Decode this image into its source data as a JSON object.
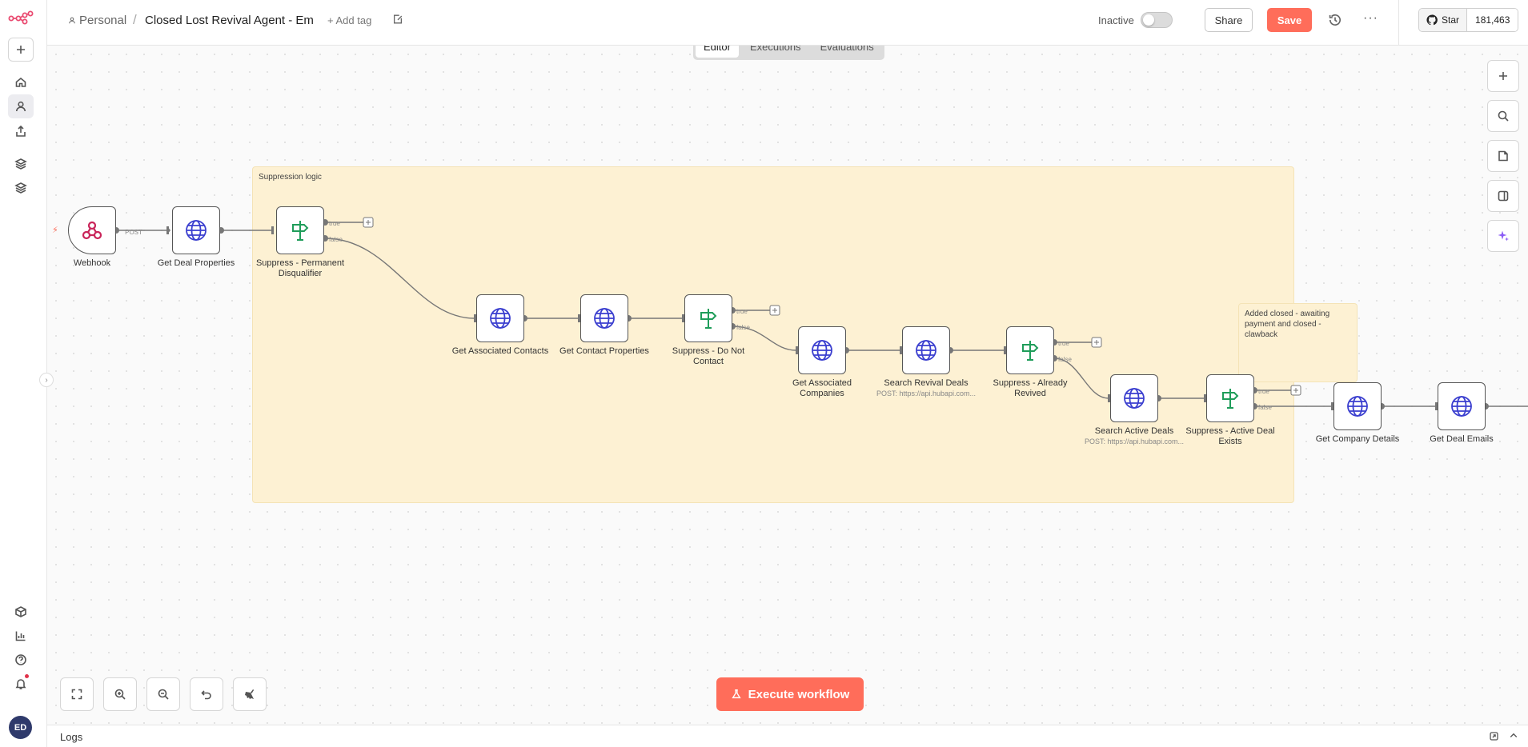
{
  "header": {
    "owner": "Personal",
    "separator": "/",
    "title": "Closed Lost Revival Agent - Em",
    "add_tag": "+ Add tag",
    "status_label": "Inactive",
    "share": "Share",
    "save": "Save",
    "more": "···",
    "github_star": "Star",
    "github_count": "181,463"
  },
  "tabs": [
    {
      "label": "Editor",
      "active": true
    },
    {
      "label": "Executions",
      "active": false
    },
    {
      "label": "Evaluations",
      "active": false
    }
  ],
  "stickies": {
    "suppression": "Suppression logic",
    "awaiting": "Added closed - awaiting payment and closed - clawback"
  },
  "nodes": {
    "webhook": {
      "label": "Webhook",
      "icon": "webhook-icon"
    },
    "get_deal_properties": {
      "label": "Get Deal Properties",
      "icon": "globe-icon"
    },
    "suppress_permanent": {
      "label": "Suppress - Permanent Disqualifier",
      "icon": "signpost-icon"
    },
    "get_associated_contacts": {
      "label": "Get Associated Contacts",
      "icon": "globe-icon"
    },
    "get_contact_properties": {
      "label": "Get Contact Properties",
      "icon": "globe-icon"
    },
    "suppress_do_not_contact": {
      "label": "Suppress - Do Not Contact",
      "icon": "signpost-icon"
    },
    "get_associated_companies": {
      "label": "Get Associated Companies",
      "icon": "globe-icon"
    },
    "search_revival_deals": {
      "label": "Search Revival Deals",
      "sub": "POST: https://api.hubapi.com...",
      "icon": "globe-icon"
    },
    "suppress_already_revived": {
      "label": "Suppress - Already Revived",
      "icon": "signpost-icon"
    },
    "search_active_deals": {
      "label": "Search Active Deals",
      "sub": "POST: https://api.hubapi.com...",
      "icon": "globe-icon"
    },
    "suppress_active_deal": {
      "label": "Suppress - Active Deal Exists",
      "icon": "signpost-icon"
    },
    "get_company_details": {
      "label": "Get Company Details",
      "icon": "globe-icon"
    },
    "get_deal_emails": {
      "label": "Get Deal Emails",
      "icon": "globe-icon"
    }
  },
  "edge_labels": {
    "post": "POST",
    "true": "true",
    "false": "false"
  },
  "execute_button": "Execute workflow",
  "logs_label": "Logs",
  "user_initials": "ED",
  "colors": {
    "accent": "#ff6d5a",
    "globe": "#3b3fcf",
    "signpost": "#1f9d5a",
    "sticky": "#fdf1d3"
  }
}
